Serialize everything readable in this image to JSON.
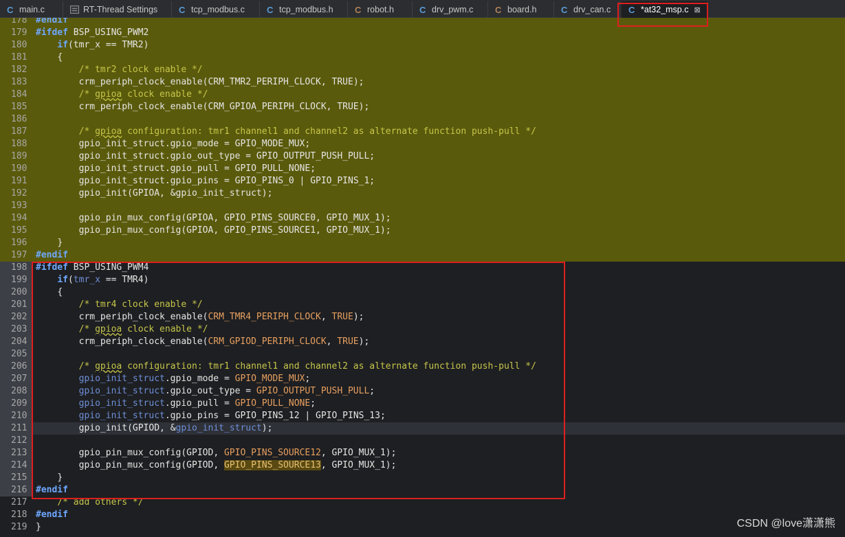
{
  "tabs": [
    {
      "label": "main.c",
      "icon": "c-file-icon"
    },
    {
      "label": "RT-Thread Settings",
      "icon": "settings-sheet-icon"
    },
    {
      "label": "tcp_modbus.c",
      "icon": "c-file-icon"
    },
    {
      "label": "tcp_modbus.h",
      "icon": "c-file-icon"
    },
    {
      "label": "robot.h",
      "icon": "h-file-icon"
    },
    {
      "label": "drv_pwm.c",
      "icon": "c-file-icon"
    },
    {
      "label": "board.h",
      "icon": "h-file-icon"
    },
    {
      "label": "drv_can.c",
      "icon": "c-file-icon"
    },
    {
      "label": "*at32_msp.c",
      "icon": "c-file-icon",
      "active": true,
      "close": "⊠"
    }
  ],
  "editor": {
    "line_numbers": [
      "178",
      "179",
      "180",
      "181",
      "182",
      "183",
      "184",
      "185",
      "186",
      "187",
      "188",
      "189",
      "190",
      "191",
      "192",
      "193",
      "194",
      "195",
      "196",
      "197",
      "198",
      "199",
      "200",
      "201",
      "202",
      "203",
      "204",
      "205",
      "206",
      "207",
      "208",
      "209",
      "210",
      "211",
      "212",
      "213",
      "214",
      "215",
      "216",
      "217",
      "218",
      "219"
    ],
    "tokens": {
      "endif": "#endif",
      "ifdef": "#ifdef",
      "bsp_pwm2": " BSP_USING_PWM2",
      "bsp_pwm4": " BSP_USING_PWM4",
      "if": "if",
      "tmr_x": "tmr_x",
      "tmr2": "TMR2",
      "tmr4": "TMR4",
      "lbrace": "{",
      "rbrace": "}",
      "cm_tmr2": "/* tmr2 clock enable */",
      "cm_tmr4": "/* tmr4 clock enable */",
      "crm_fn": "crm_periph_clock_enable",
      "crm_tmr2": "CRM_TMR2_PERIPH_CLOCK",
      "crm_tmr4": "CRM_TMR4_PERIPH_CLOCK",
      "crm_gpioa": "CRM_GPIOA_PERIPH_CLOCK",
      "crm_gpiod": "CRM_GPIOD_PERIPH_CLOCK",
      "true": "TRUE",
      "cm_open": "/* ",
      "gpioa": "gpioa",
      "cm_clock_tail": " clock enable */",
      "cm_config_tail": " configuration: tmr1 channel1 and channel2 as alternate function push-pull */",
      "gis": "gpio_init_struct",
      "gpio_mode": ".gpio_mode",
      "gpio_out_type": ".gpio_out_type",
      "gpio_pull": ".gpio_pull",
      "gpio_pins": ".gpio_pins",
      "mode_mux": "GPIO_MODE_MUX",
      "out_pp": "GPIO_OUTPUT_PUSH_PULL",
      "pull_none": "GPIO_PULL_NONE",
      "pins_0": "GPIO_PINS_0",
      "pins_1": "GPIO_PINS_1",
      "pins_12": "GPIO_PINS_12",
      "pins_13": "GPIO_PINS_13",
      "gpio_init": "gpio_init",
      "gpioa_c": "GPIOA",
      "gpiod_c": "GPIOD",
      "mux_config": "gpio_pin_mux_config",
      "src0": "GPIO_PINS_SOURCE0",
      "src1": "GPIO_PINS_SOURCE1",
      "src12": "GPIO_PINS_SOURCE12",
      "src13": "GPIO_PINS_SOURCE13",
      "mux1": "GPIO_MUX_1",
      "cm_add_others": "/* add others */"
    }
  },
  "watermark": "CSDN @love潇潇熊",
  "colors": {
    "highlight_block": "#5a5a0c",
    "annotation": "#e01e1e",
    "keyword": "#6fa8ff",
    "comment": "#c6c64a"
  }
}
